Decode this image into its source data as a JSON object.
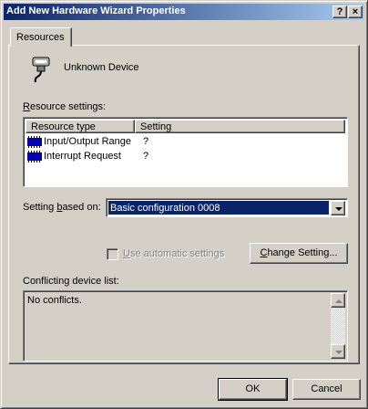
{
  "window": {
    "title": "Add New Hardware Wizard Properties",
    "help_glyph": "?",
    "close_glyph": "×"
  },
  "tabs": [
    {
      "label": "Resources",
      "active": true
    }
  ],
  "device": {
    "name": "Unknown Device",
    "icon": "serial-connector-icon"
  },
  "resource_settings": {
    "label_accel": "R",
    "label_rest": "esource settings:",
    "columns": [
      "Resource type",
      "Setting"
    ],
    "rows": [
      {
        "type": "Input/Output Range",
        "setting": "?",
        "icon": "chip-icon"
      },
      {
        "type": "Interrupt Request",
        "setting": "?",
        "icon": "chip-icon"
      }
    ]
  },
  "setting_based_on": {
    "label_pre": "Setting ",
    "label_accel": "b",
    "label_post": "ased on:",
    "value": "Basic configuration 0008"
  },
  "auto_settings": {
    "label_accel": "U",
    "label_rest": "se automatic settings",
    "checked": false,
    "enabled": false
  },
  "change_setting": {
    "label_accel": "C",
    "label_rest": "hange Setting..."
  },
  "conflicts": {
    "label": "Conflicting device list:",
    "text": "No conflicts."
  },
  "footer": {
    "ok": "OK",
    "cancel": "Cancel"
  },
  "colors": {
    "title_start": "#0a246a",
    "title_end": "#a6caf0",
    "face": "#d4d0c8",
    "selection": "#0a246a"
  }
}
